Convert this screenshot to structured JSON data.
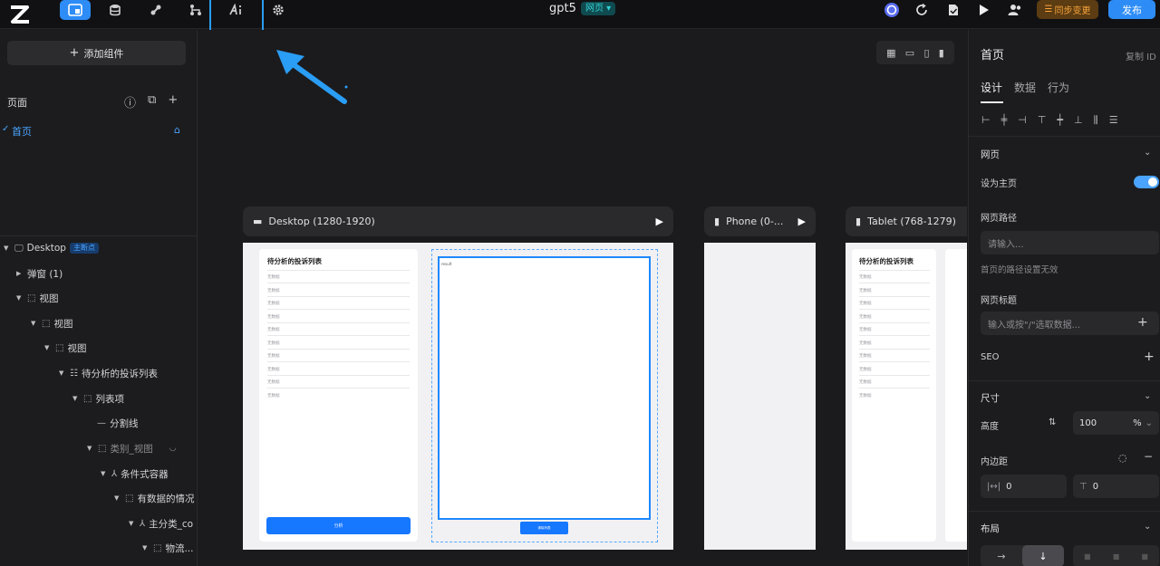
{
  "topbar": {
    "project_name": "gpt5",
    "page_type_badge": "网页 ▾",
    "sync_label": "同步变更",
    "publish_label": "发布",
    "icons": [
      "logo-icon",
      "pages-icon",
      "database-icon",
      "plugin-icon",
      "workflow-icon",
      "ai-icon",
      "settings-icon",
      "chat-bot-icon",
      "refresh-icon",
      "file-check-icon",
      "play-icon",
      "users-icon"
    ]
  },
  "left": {
    "add_component": "添加组件",
    "pages_label": "页面",
    "pages": [
      {
        "label": "首页",
        "is_home": true
      }
    ],
    "tree": [
      {
        "label": "Desktop",
        "tag": "主断点"
      },
      {
        "label": "弹窗 (1)"
      },
      {
        "label": "视图"
      },
      {
        "label": "视图"
      },
      {
        "label": "视图"
      },
      {
        "label": "待分析的投诉列表"
      },
      {
        "label": "列表项"
      },
      {
        "label": "分割线"
      },
      {
        "label": "类别_视图"
      },
      {
        "label": "条件式容器"
      },
      {
        "label": "有数据的情况"
      },
      {
        "label": "主分类_co"
      },
      {
        "label": "物流..."
      }
    ]
  },
  "canvas": {
    "desktop_label": "Desktop (1280-1920)",
    "phone_label": "Phone (0-...",
    "tablet_label": "Tablet (768-1279)",
    "card_title": "待分析的投诉列表",
    "list_item_text": "无数据",
    "analyze_button": "分析",
    "result_placeholder": "result",
    "small_button": "清除列表"
  },
  "right": {
    "title": "首页",
    "copy_id": "复制 ID",
    "tabs": [
      "设计",
      "数据",
      "行为"
    ],
    "section_web": "网页",
    "set_home": "设为主页",
    "path_label": "网页路径",
    "path_placeholder": "请输入...",
    "path_hint": "首页的路径设置无效",
    "page_title_label": "网页标题",
    "page_title_placeholder": "输入或按\"/\"选取数据...",
    "seo_label": "SEO",
    "size_label": "尺寸",
    "height_label": "高度",
    "height_value": "100",
    "height_unit": "%",
    "padding_label": "内边距",
    "padding_h": "0",
    "padding_v": "0",
    "layout_label": "布局"
  },
  "colors": {
    "accent": "#2d8cf6",
    "highlight": "#2a9df4",
    "sync": "#f7a43b",
    "badge": "#33d1d4"
  }
}
